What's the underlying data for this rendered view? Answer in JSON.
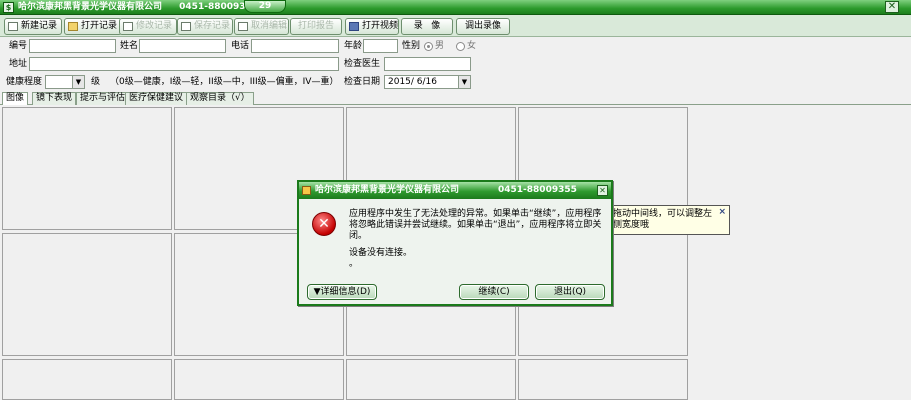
{
  "window": {
    "title": "哈尔滨康邦黑背景光学仪器有限公司",
    "phone_partial": "0451-8800935",
    "tab_number": "29",
    "close_glyph": "✕"
  },
  "toolbar": {
    "new_record": "新建记录",
    "open_record": "打开记录",
    "edit_record": "修改记录",
    "save_record": "保存记录",
    "cancel_edit": "取消编辑",
    "print_report": "打印报告",
    "open_video": "打开视频",
    "record": "录   像",
    "export_image": "调出录像"
  },
  "form": {
    "labels": {
      "id": "编号",
      "name": "姓名",
      "phone": "电话",
      "age": "年龄",
      "gender": "性别",
      "male": "男",
      "female": "女",
      "address": "地址",
      "doctor": "检查医生",
      "health_level": "健康程度",
      "level_unit": "级",
      "level_desc": "（0级—健康，I级—轻，II级—中，III级—偏重，IV—重）",
      "check_date": "检查日期"
    },
    "values": {
      "id": "",
      "name": "",
      "phone": "",
      "age": "",
      "address": "",
      "doctor": "",
      "health_level": "",
      "check_date": "2015/ 6/16"
    },
    "gender_selected": "男"
  },
  "tabs": [
    "图像",
    "镜下表现",
    "提示与评估",
    "医疗保健建议",
    "观察目录（√）"
  ],
  "tooltip": {
    "text": "拖动中间线，可以调整左侧宽度哦",
    "close_glyph": "×"
  },
  "dialog": {
    "title": "哈尔滨康邦黑背景光学仪器有限公司",
    "phone": "0451-88009355",
    "close_glyph": "✕",
    "icon_glyph": "✕",
    "message": "应用程序中发生了无法处理的异常。如果单击“继续”，应用程序将忽略此错误并尝试继续。如果单击“退出”，应用程序将立即关闭。",
    "detail": "设备没有连接。",
    "detail2": "。",
    "buttons": {
      "details": "▼详细信息(D)",
      "continue": "继续(C)",
      "quit": "退出(Q)"
    }
  },
  "colors": {
    "accent_green": "#2c9a2c",
    "error_red": "#c40000"
  }
}
